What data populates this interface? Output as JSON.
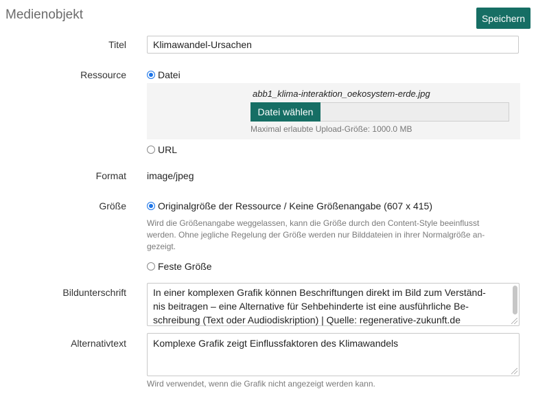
{
  "header": {
    "title": "Medienobjekt",
    "save_label": "Speichern"
  },
  "form": {
    "titel": {
      "label": "Titel",
      "value": "Klimawandel-Ursachen"
    },
    "ressource": {
      "label": "Ressource",
      "option_datei": "Datei",
      "filename": "abb1_klima-interaktion_oekosystem-erde.jpg",
      "choose_file": "Datei wählen",
      "max_upload": "Maximal erlaubte Upload-Größe: 1000.0 MB",
      "option_url": "URL",
      "selected": "Datei"
    },
    "format": {
      "label": "Format",
      "value": "image/jpeg"
    },
    "groesse": {
      "label": "Größe",
      "option_original": "Originalgröße der Ressource / Keine Größenangabe (607 x 415)",
      "help_line1": "Wird die Größenangabe weggelassen, kann die Größe durch den Content-Style beeinflusst",
      "help_line2": "werden. Ohne jegliche Regelung der Größe werden nur Bilddateien in ihrer Normalgröße an-",
      "help_line3": "gezeigt.",
      "option_fest": "Feste Größe",
      "selected": "Originalgröße"
    },
    "bildunterschrift": {
      "label": "Bildunterschrift",
      "line1": "In einer komplexen Grafik können Beschriftungen direkt im Bild zum Verständ-",
      "line2": "nis beitragen – eine Alternative für Sehbehinderte ist eine ausführliche Be-",
      "line3": "schreibung (Text oder Audiodiskription) | Quelle: regenerative-zukunft.de"
    },
    "alternativtext": {
      "label": "Alternativtext",
      "value": "Komplexe Grafik zeigt Einflussfaktoren des Klimawandels",
      "help": "Wird verwendet, wenn die Grafik nicht angezeigt werden kann."
    }
  }
}
